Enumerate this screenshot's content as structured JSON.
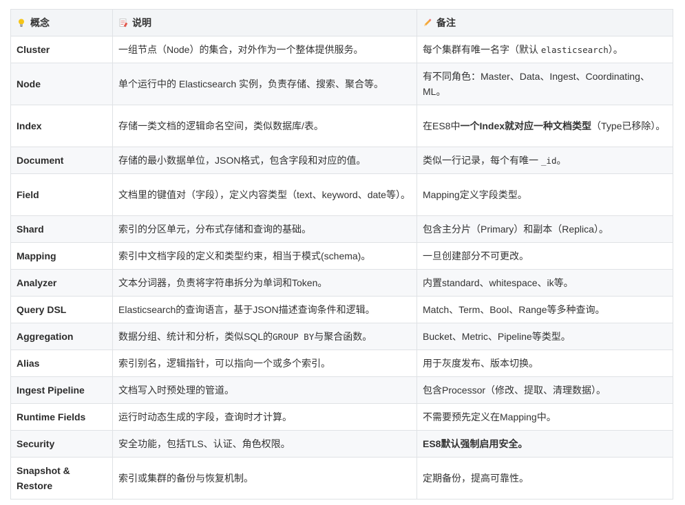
{
  "header": {
    "col1": {
      "icon": "lightbulb-icon",
      "label": "概念"
    },
    "col2": {
      "icon": "memo-icon",
      "label": "说明"
    },
    "col3": {
      "icon": "pencil-icon",
      "label": "备注"
    }
  },
  "rows": [
    {
      "term": "Cluster",
      "desc": "一组节点（Node）的集合，对外作为一个整体提供服务。",
      "note": {
        "pre": "每个集群有唯一名字（默认 ",
        "code": "elasticsearch",
        "post": "）。"
      }
    },
    {
      "term": "Node",
      "desc": "单个运行中的 Elasticsearch 实例，负责存储、搜索、聚合等。",
      "note": "有不同角色：Master、Data、Ingest、Coordinating、ML。"
    },
    {
      "term": "Index",
      "desc": "存储一类文档的逻辑命名空间，类似数据库/表。",
      "note": {
        "pre": "在ES8中",
        "bold": "一个Index就对应一种文档类型",
        "post": "（Type已移除）。"
      }
    },
    {
      "term": "Document",
      "desc": "存储的最小数据单位，JSON格式，包含字段和对应的值。",
      "note": {
        "pre": "类似一行记录，每个有唯一 ",
        "code": "_id",
        "post": "。"
      }
    },
    {
      "term": "Field",
      "desc": "文档里的键值对（字段），定义内容类型（text、keyword、date等）。",
      "note": "Mapping定义字段类型。"
    },
    {
      "term": "Shard",
      "desc": "索引的分区单元，分布式存储和查询的基础。",
      "note": "包含主分片（Primary）和副本（Replica）。"
    },
    {
      "term": "Mapping",
      "desc": "索引中文档字段的定义和类型约束，相当于模式(schema)。",
      "note": "一旦创建部分不可更改。"
    },
    {
      "term": "Analyzer",
      "desc": "文本分词器，负责将字符串拆分为单词和Token。",
      "note": "内置standard、whitespace、ik等。"
    },
    {
      "term": "Query DSL",
      "desc": "Elasticsearch的查询语言，基于JSON描述查询条件和逻辑。",
      "note": "Match、Term、Bool、Range等多种查询。"
    },
    {
      "term": "Aggregation",
      "desc": {
        "pre": "数据分组、统计和分析，类似SQL的",
        "code": "GROUP BY",
        "post": "与聚合函数。"
      },
      "note": "Bucket、Metric、Pipeline等类型。"
    },
    {
      "term": "Alias",
      "desc": "索引别名，逻辑指针，可以指向一个或多个索引。",
      "note": "用于灰度发布、版本切换。"
    },
    {
      "term": "Ingest Pipeline",
      "desc": "文档写入时预处理的管道。",
      "note": "包含Processor（修改、提取、清理数据）。"
    },
    {
      "term": "Runtime Fields",
      "desc": "运行时动态生成的字段，查询时才计算。",
      "note": "不需要预先定义在Mapping中。"
    },
    {
      "term": "Security",
      "desc": "安全功能，包括TLS、认证、角色权限。",
      "note": {
        "bold": "ES8默认强制启用安全。"
      }
    },
    {
      "term": "Snapshot & Restore",
      "desc": "索引或集群的备份与恢复机制。",
      "note": "定期备份，提高可靠性。"
    }
  ]
}
